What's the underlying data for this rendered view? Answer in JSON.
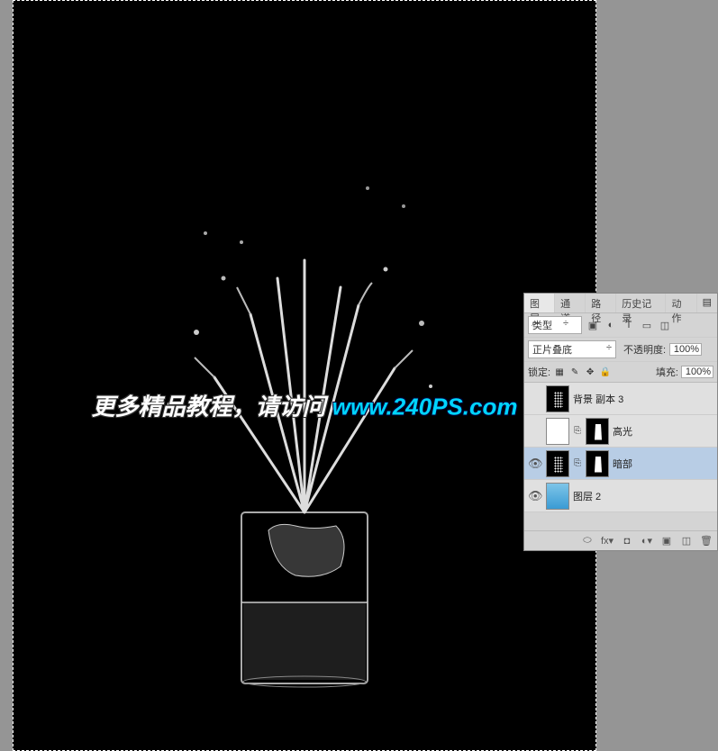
{
  "watermark": {
    "text1": "更多精品教程，请访问",
    "text2": "www.240PS.com"
  },
  "panel": {
    "tabs": [
      "图层",
      "通道",
      "路径",
      "历史记录",
      "动作"
    ],
    "active_tab": 0,
    "type_label": "类型",
    "blend_mode": "正片叠底",
    "opacity_label": "不透明度:",
    "opacity_value": "100%",
    "lock_label": "锁定:",
    "fill_label": "填充:",
    "fill_value": "100%",
    "layers": [
      {
        "visible": false,
        "name": "背景 副本 3",
        "thumb": "splash",
        "mask": false,
        "selected": false
      },
      {
        "visible": false,
        "name": "高光",
        "thumb": "white",
        "mask": true,
        "selected": false
      },
      {
        "visible": true,
        "name": "暗部",
        "thumb": "splash",
        "mask": true,
        "selected": true
      },
      {
        "visible": true,
        "name": "图层 2",
        "thumb": "blue",
        "mask": false,
        "selected": false
      }
    ]
  }
}
